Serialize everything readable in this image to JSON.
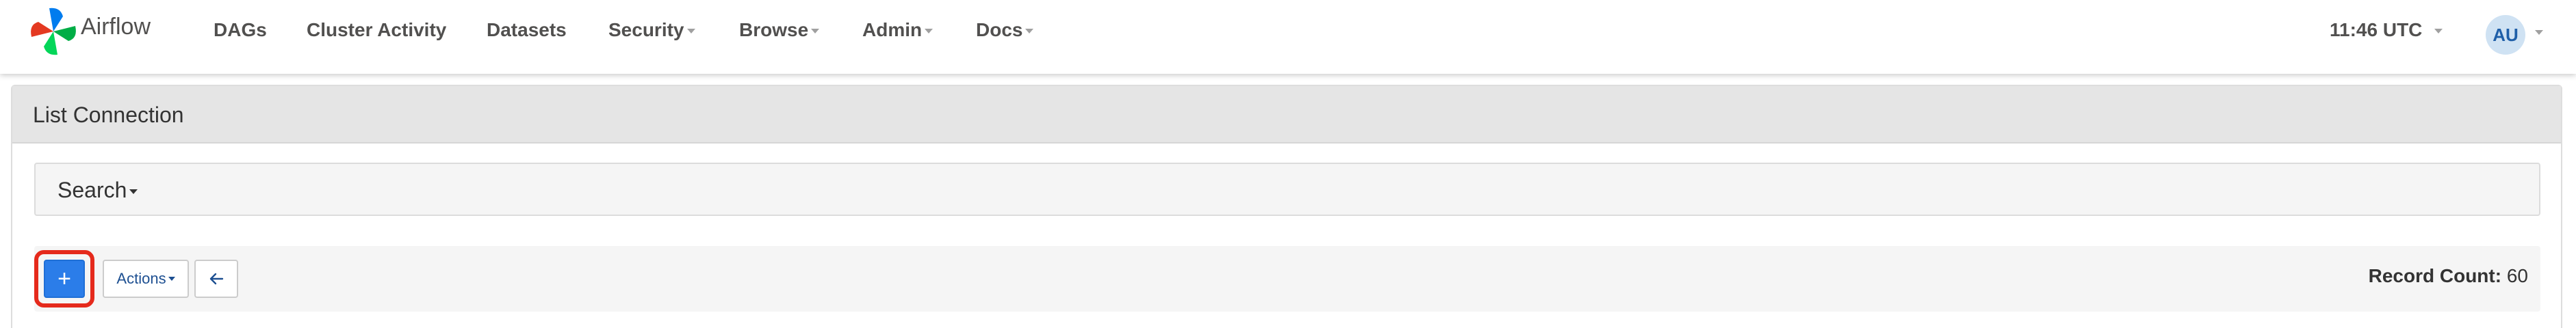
{
  "navbar": {
    "brand": {
      "name": "Airflow",
      "icon": "airflow-pinwheel-icon"
    },
    "items": [
      {
        "label": "DAGs",
        "dropdown": false
      },
      {
        "label": "Cluster Activity",
        "dropdown": false
      },
      {
        "label": "Datasets",
        "dropdown": false
      },
      {
        "label": "Security",
        "dropdown": true
      },
      {
        "label": "Browse",
        "dropdown": true
      },
      {
        "label": "Admin",
        "dropdown": true
      },
      {
        "label": "Docs",
        "dropdown": true
      }
    ],
    "clock": "11:46 UTC",
    "user": {
      "initials": "AU"
    }
  },
  "page": {
    "title": "List Connection",
    "search_label": "Search",
    "toolbar": {
      "add_label": "+",
      "actions_label": "Actions",
      "back_icon": "arrow-left-icon",
      "record_count_label": "Record Count:",
      "record_count_value": "60"
    }
  },
  "colors": {
    "primary_button": "#2b7de9",
    "highlight": "#e52a1c",
    "link_blue": "#1d4f91",
    "avatar_bg": "#cfe2f3"
  }
}
